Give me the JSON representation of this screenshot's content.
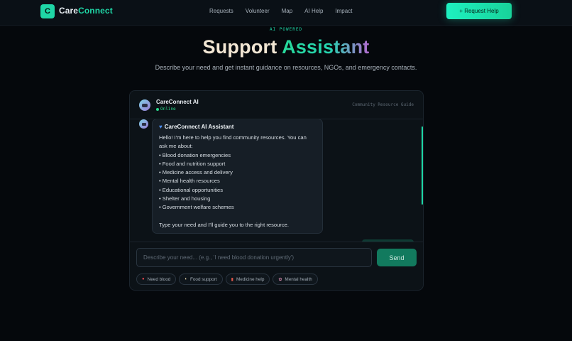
{
  "nav": {
    "logo_letter": "C",
    "brand_part1": "Care",
    "brand_part2": "Connect",
    "links": [
      "Requests",
      "Volunteer",
      "Map",
      "AI Help",
      "Impact"
    ],
    "cta_label": "+ Request Help"
  },
  "hero": {
    "eyebrow": "AI POWERED",
    "title_part1": "Support",
    "title_part2": "Assistant",
    "subtitle": "Describe your need and get instant guidance on resources, NGOs, and emergency contacts."
  },
  "chat": {
    "bot_name": "CareConnect AI",
    "status": "Online",
    "header_right": "Community Resource Guide",
    "message": {
      "icon": "blue-heart-icon",
      "title": "CareConnect AI Assistant",
      "intro": "Hello! I'm here to help you find community resources. You can ask me about:",
      "items": [
        "• Blood donation emergencies",
        "• Food and nutrition support",
        "• Medicine access and delivery",
        "• Mental health resources",
        "• Educational opportunities",
        "• Shelter and housing",
        "• Government welfare schemes"
      ],
      "outro": "Type your need and I'll guide you to the right resource."
    },
    "input": {
      "placeholder": "Describe your need... (e.g., 'I need blood donation urgently')",
      "value": ""
    },
    "send_label": "Send",
    "chips": [
      {
        "icon": "blood-drop-icon",
        "label": "Need blood"
      },
      {
        "icon": "rice-bowl-icon",
        "label": "Food support"
      },
      {
        "icon": "pill-icon",
        "label": "Medicine help"
      },
      {
        "icon": "brain-icon",
        "label": "Mental health"
      }
    ]
  },
  "colors": {
    "accent": "#1fd6a6",
    "background": "#05080c",
    "card": "#0c1217",
    "online": "#2bd98c"
  }
}
